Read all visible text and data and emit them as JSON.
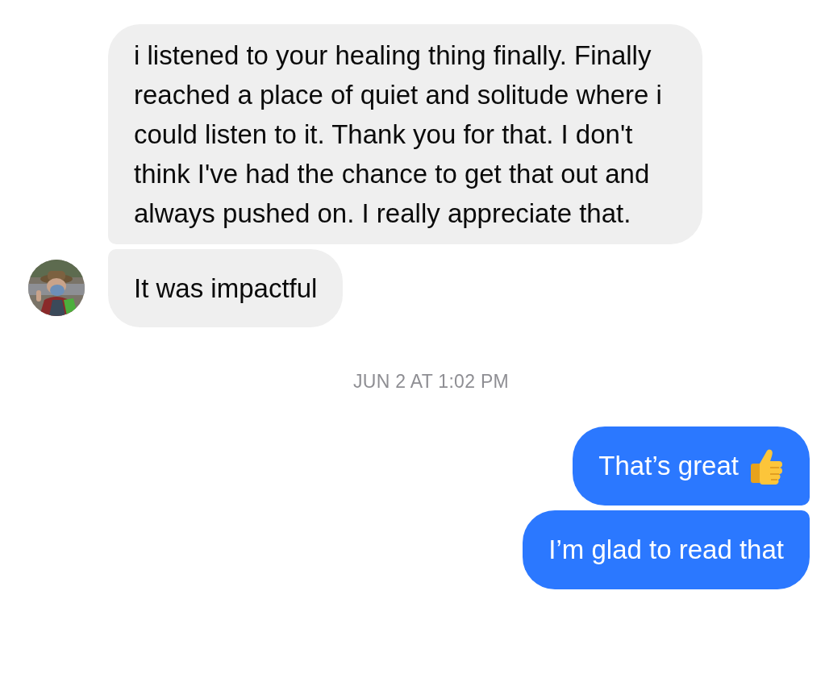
{
  "items": [
    {
      "kind": "incoming",
      "text": "i listened to your healing thing finally. Finally reached a place of quiet and solitude where i could listen to it. Thank you for that. I don't think I've had the chance to get that out and always pushed on. I really appreciate that.",
      "avatar": false
    },
    {
      "kind": "incoming",
      "text": "It was impactful",
      "avatar": true
    },
    {
      "kind": "timestamp",
      "text": "JUN 2 AT 1:02 PM"
    },
    {
      "kind": "outgoing",
      "text": "That’s great",
      "thumbs_up": true
    },
    {
      "kind": "outgoing",
      "text": "I’m glad to read that",
      "thumbs_up": false
    }
  ]
}
